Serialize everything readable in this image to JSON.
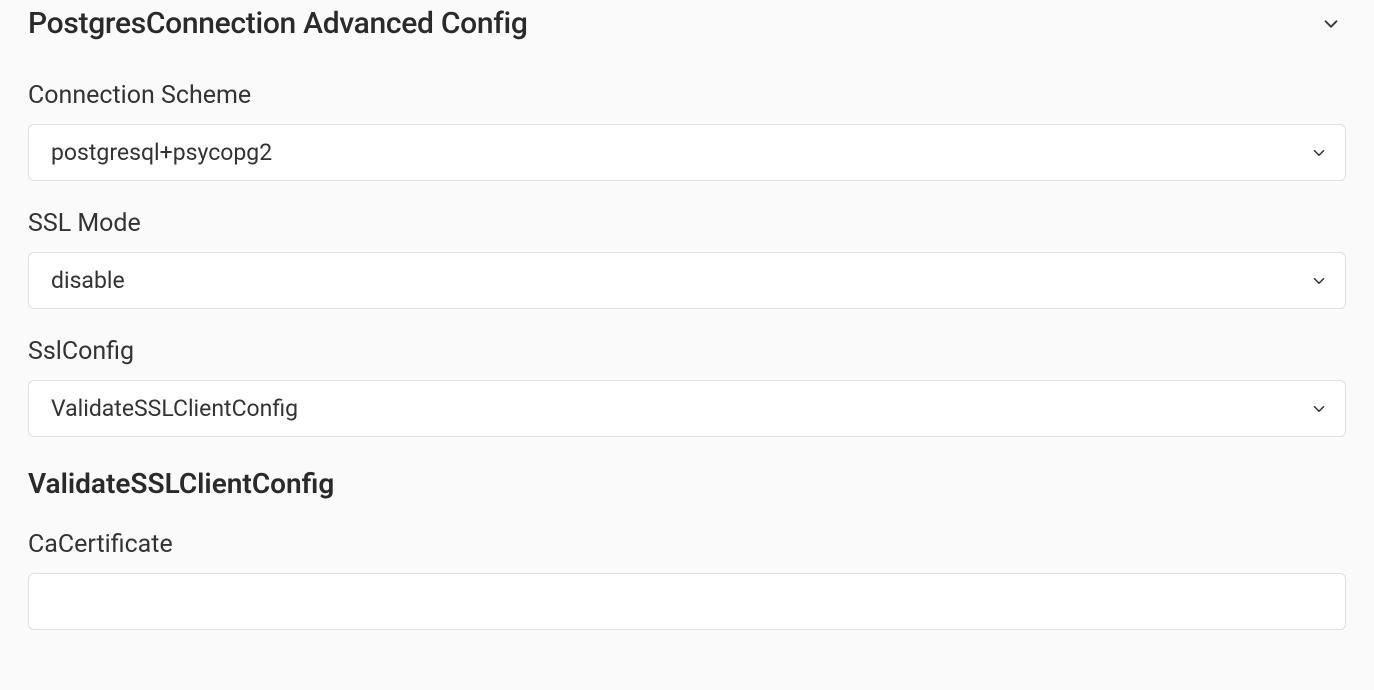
{
  "section": {
    "title": "PostgresConnection Advanced Config"
  },
  "fields": {
    "connectionScheme": {
      "label": "Connection Scheme",
      "value": "postgresql+psycopg2"
    },
    "sslMode": {
      "label": "SSL Mode",
      "value": "disable"
    },
    "sslConfig": {
      "label": "SslConfig",
      "value": "ValidateSSLClientConfig"
    }
  },
  "subsection": {
    "title": "ValidateSSLClientConfig",
    "fields": {
      "caCertificate": {
        "label": "CaCertificate",
        "value": ""
      }
    }
  }
}
